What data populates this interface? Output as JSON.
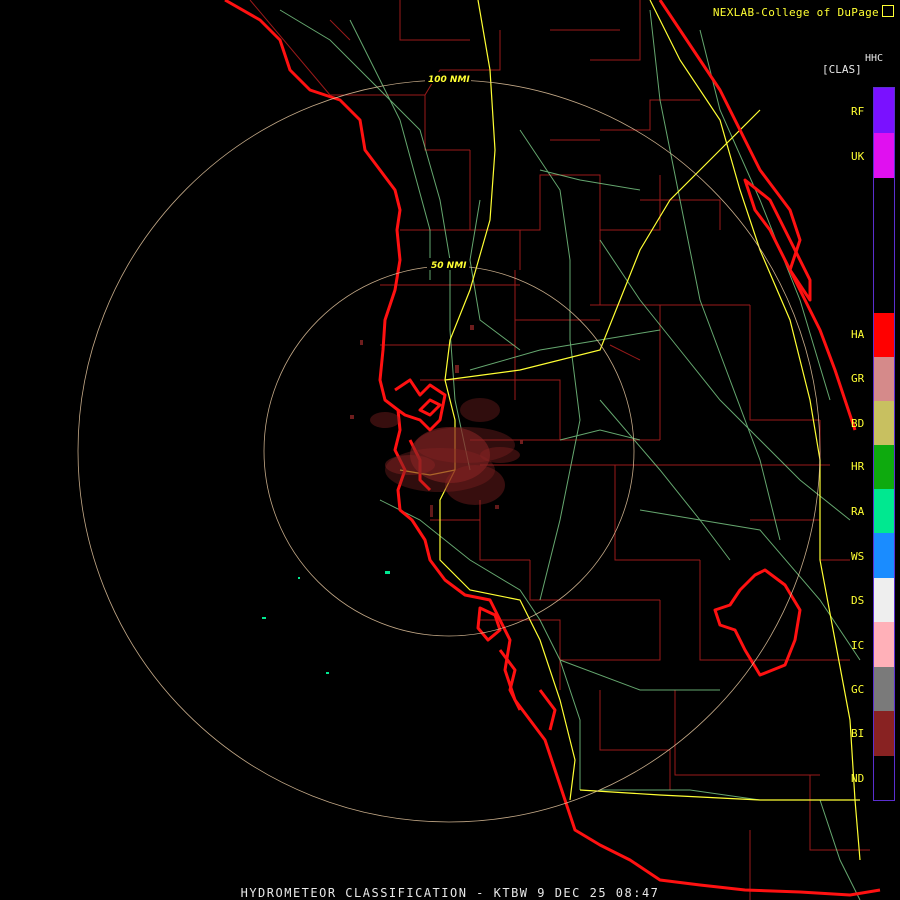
{
  "header": {
    "credit": "NEXLAB-College of DuPage"
  },
  "product": {
    "code": "HHC",
    "class_label": "[CLAS]"
  },
  "legend": [
    {
      "label": "RF",
      "color": "#7a11ff"
    },
    {
      "label": "UK",
      "color": "#e010f0"
    },
    {
      "label": "HA",
      "color": "#ff0000"
    },
    {
      "label": "GR",
      "color": "#d58a8a"
    },
    {
      "label": "BD",
      "color": "#c8c060"
    },
    {
      "label": "HR",
      "color": "#0eaa0e"
    },
    {
      "label": "RA",
      "color": "#00e890"
    },
    {
      "label": "WS",
      "color": "#1a8cff"
    },
    {
      "label": "DS",
      "color": "#eeeeee"
    },
    {
      "label": "IC",
      "color": "#ffb0b8"
    },
    {
      "label": "GC",
      "color": "#7a7a7a"
    },
    {
      "label": "BI",
      "color": "#882222"
    },
    {
      "label": "ND",
      "color": "#000000"
    }
  ],
  "rings": {
    "inner": "50 NMI",
    "outer": "100 NMI"
  },
  "footer": {
    "title": "HYDROMETEOR CLASSIFICATION - KTBW 9 DEC 25 08:47"
  }
}
